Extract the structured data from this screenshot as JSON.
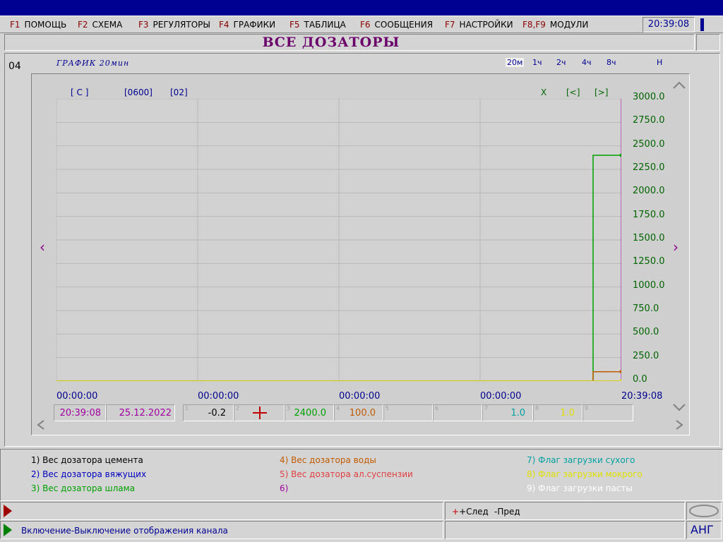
{
  "menu": [
    {
      "key": "F1",
      "label": "ПОМОЩЬ"
    },
    {
      "key": "F2",
      "label": "СХЕМА"
    },
    {
      "key": "F3",
      "label": "РЕГУЛЯТОРЫ"
    },
    {
      "key": "F4",
      "label": "ГРАФИКИ"
    },
    {
      "key": "F5",
      "label": "ТАБЛИЦА"
    },
    {
      "key": "F6",
      "label": "СООБЩЕНИЯ"
    },
    {
      "key": "F7",
      "label": "НАСТРОЙКИ"
    },
    {
      "key": "F8,F9",
      "label": "МОДУЛИ"
    }
  ],
  "clock": "20:39:08",
  "page_title": "ВСЕ  ДОЗАТОРЫ",
  "panel_number": "04",
  "graph_label": "ГРАФИК  20мин",
  "ranges": [
    "20м",
    "1ч",
    "2ч",
    "4ч",
    "8ч",
    "Н"
  ],
  "chart_controls": {
    "tag1": "[ С ]",
    "tag2": "[0600]",
    "tag3": "[02]",
    "x_btn": "X",
    "prev_btn": "[<]",
    "next_btn": "[>]"
  },
  "chart_data": {
    "type": "line",
    "ylim": [
      0,
      3000
    ],
    "y_ticks": [
      "3000.0",
      "2750.0",
      "2500.0",
      "2250.0",
      "2000.0",
      "1750.0",
      "1500.0",
      "1250.0",
      "1000.0",
      "750.0",
      "500.0",
      "250.0",
      "0.0"
    ],
    "x_ticks": [
      "00:00:00",
      "00:00:00",
      "00:00:00",
      "00:00:00",
      "20:39:08"
    ],
    "series": [
      {
        "values": [
          0,
          0,
          2400,
          2400
        ],
        "color": "#00a000"
      },
      {
        "values": [
          0,
          0,
          100,
          100
        ],
        "color": "#c05a00"
      },
      {
        "values": [
          0,
          0,
          0,
          0
        ],
        "color": "#000000"
      },
      {
        "values": [
          1,
          1,
          1,
          1
        ],
        "color": "#e0e000"
      }
    ]
  },
  "status_row": {
    "time": "20:39:08",
    "date": "25.12.2022",
    "cells": [
      {
        "n": "1",
        "v": "-0.2",
        "color": "#000000"
      },
      {
        "n": "2",
        "v": "",
        "color": "#000000"
      },
      {
        "n": "3",
        "v": "2400.0",
        "color": "#00a000"
      },
      {
        "n": "4",
        "v": "100.0",
        "color": "#c05a00"
      },
      {
        "n": "5",
        "v": "",
        "color": "#000000"
      },
      {
        "n": "6",
        "v": "",
        "color": "#000000"
      },
      {
        "n": "7",
        "v": "1.0",
        "color": "#00a0a0"
      },
      {
        "n": "8",
        "v": "1.0",
        "color": "#e0e000"
      },
      {
        "n": "9",
        "v": "",
        "color": "#000000"
      }
    ]
  },
  "legend": [
    {
      "text": "1) Вес дозатора цемента",
      "color": "#000000"
    },
    {
      "text": "2) Вес дозатора вяжущих",
      "color": "#0000c0"
    },
    {
      "text": "3) Вес дозатора шлама",
      "color": "#00a000"
    },
    {
      "text": "4) Вес дозатора воды",
      "color": "#c05a00"
    },
    {
      "text": "5) Вес дозатора ал.суспензии",
      "color": "#e04040"
    },
    {
      "text": "6)",
      "color": "#a000a0"
    },
    {
      "text": "7) Флаг загрузки сухого",
      "color": "#00a0a0"
    },
    {
      "text": "8) Флаг загрузки мокрого",
      "color": "#e0e000"
    },
    {
      "text": "9) Флаг загрузки пасты",
      "color": "#ffffff"
    }
  ],
  "bottom": {
    "next_label": "+След",
    "prev_label": "-Пред",
    "status_message": "Включение-Выключение отображения канала",
    "lang": "АНГ"
  }
}
